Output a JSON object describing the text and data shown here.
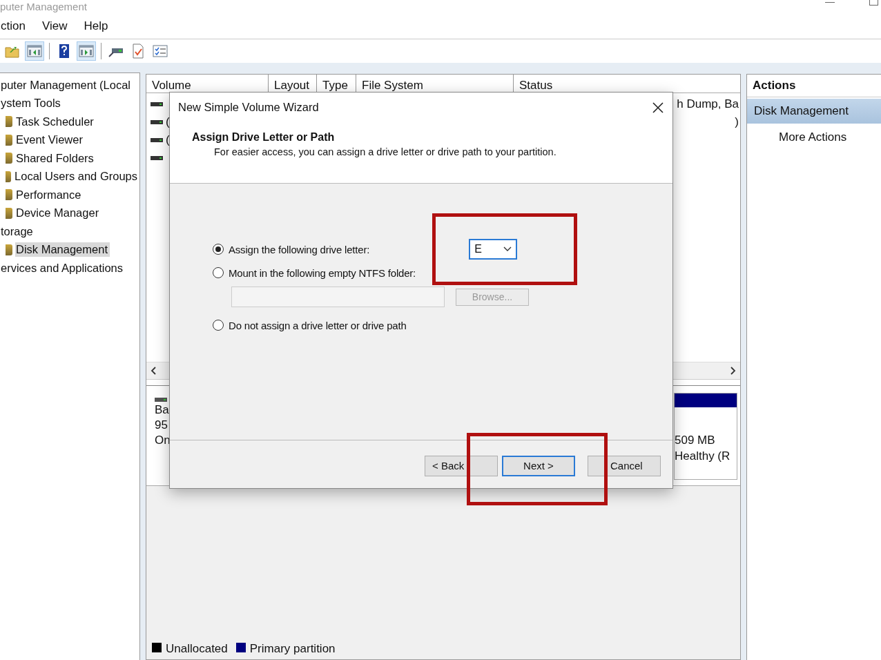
{
  "window": {
    "title": "puter Management"
  },
  "menu": [
    "ction",
    "View",
    "Help"
  ],
  "toolbar_buttons": [
    {
      "pressed": false
    },
    {
      "pressed": true
    },
    {
      "pressed": false
    },
    {
      "pressed": true
    },
    {
      "pressed": false
    },
    {
      "pressed": false
    },
    {
      "pressed": false
    }
  ],
  "tree": [
    {
      "label": "puter Management (Local",
      "selected": false,
      "children": [
        {
          "label": "ystem Tools",
          "selected": false,
          "children": [
            {
              "label": "Task Scheduler",
              "selected": false
            },
            {
              "label": "Event Viewer",
              "selected": false
            },
            {
              "label": "Shared Folders",
              "selected": false
            },
            {
              "label": "Local Users and Groups",
              "selected": false
            },
            {
              "label": "Performance",
              "selected": false
            },
            {
              "label": "Device Manager",
              "selected": false
            }
          ]
        },
        {
          "label": "torage",
          "selected": false,
          "children": [
            {
              "label": "Disk Management",
              "selected": true
            }
          ]
        },
        {
          "label": "ervices and Applications",
          "selected": false
        }
      ]
    }
  ],
  "table": {
    "columns": [
      "Volume",
      "Layout",
      "Type",
      "File System",
      "Status"
    ],
    "rows": [
      {
        "status": "h Dump, Ba"
      },
      {
        "volume": "(",
        "status": ")"
      },
      {
        "volume": "("
      },
      {}
    ]
  },
  "disk": {
    "label_lines": [
      "Ba",
      "95",
      "On"
    ],
    "partition": {
      "size": "509 MB",
      "status": "Healthy (R"
    }
  },
  "legend": [
    {
      "label": "Unallocated",
      "color": "#000000"
    },
    {
      "label": "Primary partition",
      "color": "#000080"
    }
  ],
  "actions": {
    "title": "Actions",
    "items": [
      {
        "label": "Disk Management",
        "selected": true
      },
      {
        "label": "More Actions",
        "selected": false
      }
    ]
  },
  "dialog": {
    "title": "New Simple Volume Wizard",
    "heading": "Assign Drive Letter or Path",
    "subtitle": "For easier access, you can assign a drive letter or drive path to your partition.",
    "options": [
      {
        "label": "Assign the following drive letter:",
        "selected": true
      },
      {
        "label": "Mount in the following empty NTFS folder:",
        "selected": false
      },
      {
        "label": "Do not assign a drive letter or drive path",
        "selected": false
      }
    ],
    "drive_letter": {
      "value": "E"
    },
    "browse_button": {
      "label": "Browse...",
      "disabled": true
    },
    "buttons": [
      {
        "label": "< Back",
        "default": false
      },
      {
        "label": "Next >",
        "default": true
      },
      {
        "label": "Cancel",
        "default": false
      }
    ]
  }
}
